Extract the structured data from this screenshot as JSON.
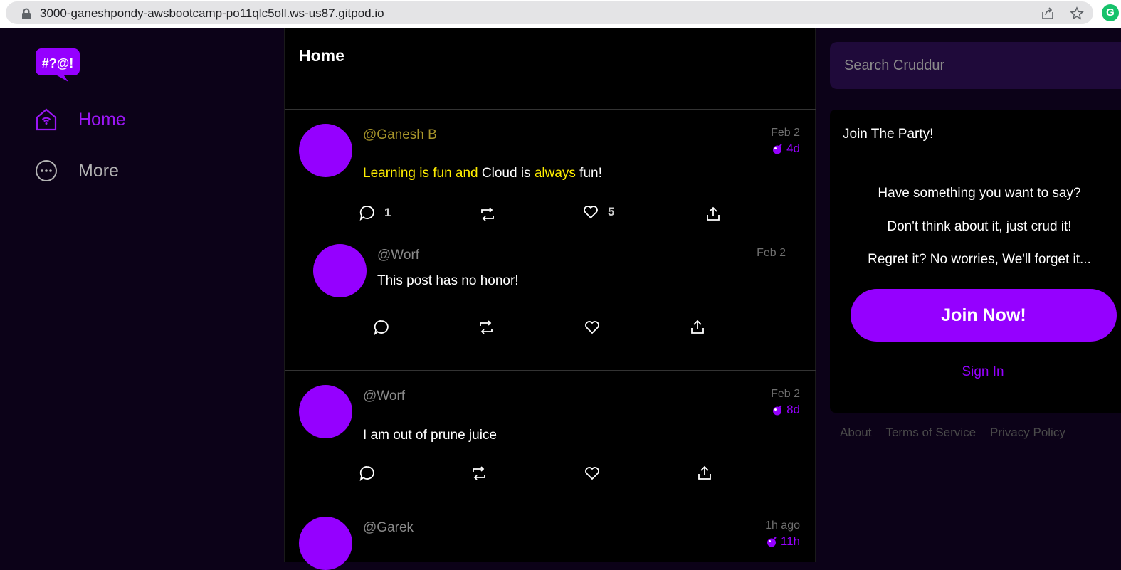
{
  "browser": {
    "url": "3000-ganeshpondy-awsbootcamp-po11qlc5oll.ws-us87.gitpod.io"
  },
  "sidebar": {
    "logo_text": "#?@!",
    "items": [
      {
        "label": "Home",
        "icon": "home-icon",
        "active": true
      },
      {
        "label": "More",
        "icon": "more-icon",
        "active": false
      }
    ]
  },
  "feed": {
    "title": "Home",
    "posts": [
      {
        "handle": "@Ganesh B",
        "created": "Feb 2",
        "expires": "4d",
        "message_parts": [
          "Learning is fun and",
          " Cloud is ",
          "always",
          " fun!"
        ],
        "reply_count": "1",
        "like_count": "5",
        "reply": {
          "handle": "@Worf",
          "created": "Feb 2",
          "message": "This post has no honor!"
        }
      },
      {
        "handle": "@Worf",
        "created": "Feb 2",
        "expires": "8d",
        "message": "I am out of prune juice"
      },
      {
        "handle": "@Garek",
        "created": "1h ago",
        "expires": "11h"
      }
    ]
  },
  "right": {
    "search_placeholder": "Search Cruddur",
    "party": {
      "title": "Join The Party!",
      "line1": "Have something you want to say?",
      "line2": "Don't think about it, just crud it!",
      "line3": "Regret it? No worries, We'll forget it...",
      "join_label": "Join Now!",
      "signin_label": "Sign In"
    },
    "footer": [
      "About",
      "Terms of Service",
      "Privacy Policy"
    ]
  },
  "colors": {
    "accent": "#9500ff",
    "highlight": "#ffee00",
    "sidebar_bg": "#0c0218",
    "feed_bg": "#000000"
  }
}
